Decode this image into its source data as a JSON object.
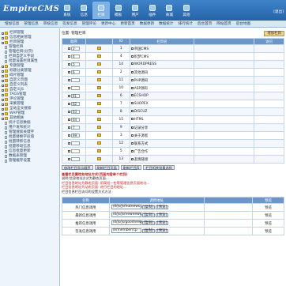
{
  "header": {
    "logo": "EmpireCMS",
    "nav": [
      {
        "label": "系统",
        "icon": "system-icon"
      },
      {
        "label": "信息",
        "icon": "info-icon"
      },
      {
        "label": "栏目",
        "icon": "column-icon",
        "active": true
      },
      {
        "label": "模板",
        "icon": "template-icon"
      },
      {
        "label": "用户",
        "icon": "user-icon"
      },
      {
        "label": "插件",
        "icon": "plugin-icon"
      },
      {
        "label": "商城",
        "icon": "shop-icon"
      },
      {
        "label": "其他",
        "icon": "other-icon"
      }
    ],
    "right_text": "[退出]",
    "accent": "#2f6fb5"
  },
  "subnav": [
    "增加信息",
    "管理信息",
    "审核信息",
    "签发信息",
    "管理评论",
    "更新中心",
    "更新首页",
    "数据更新",
    "数据统计",
    "排行统计",
    "后台首页",
    "网站首页",
    "后台地图"
  ],
  "sidebar": [
    {
      "label": "栏目管理",
      "level": 0,
      "type": "folder"
    },
    {
      "label": "信息相关管理",
      "level": 0,
      "type": "folder"
    },
    {
      "label": "栏目管理",
      "level": 0,
      "type": "folder"
    },
    {
      "label": "管理栏目",
      "level": 1,
      "type": "doc"
    },
    {
      "label": "管理栏目(分页)",
      "level": 1,
      "type": "doc"
    },
    {
      "label": "栏目自定义字段",
      "level": 1,
      "type": "doc"
    },
    {
      "label": "批量设置栏目属性",
      "level": 1,
      "type": "doc"
    },
    {
      "label": "专题管理",
      "level": 0,
      "type": "folder"
    },
    {
      "label": "标题分类管理",
      "level": 0,
      "type": "folder"
    },
    {
      "label": "碎片管理",
      "level": 0,
      "type": "folder"
    },
    {
      "label": "自定义页面",
      "level": 0,
      "type": "folder"
    },
    {
      "label": "自定义列表",
      "level": 0,
      "type": "folder"
    },
    {
      "label": "自定义JS",
      "level": 0,
      "type": "folder"
    },
    {
      "label": "TAGS管理",
      "level": 0,
      "type": "folder"
    },
    {
      "label": "评论管理",
      "level": 0,
      "type": "folder"
    },
    {
      "label": "采集管理",
      "level": 0,
      "type": "folder"
    },
    {
      "label": "全站全文搜索",
      "level": 0,
      "type": "folder"
    },
    {
      "label": "WAP管理",
      "level": 0,
      "type": "folder"
    },
    {
      "label": "其他相关",
      "level": 0,
      "type": "folder"
    },
    {
      "label": "统计信息数据",
      "level": 1,
      "type": "doc"
    },
    {
      "label": "用户发布统计",
      "level": 1,
      "type": "doc"
    },
    {
      "label": "管理搜索关键字",
      "level": 1,
      "type": "doc"
    },
    {
      "label": "批量替换字段值",
      "level": 1,
      "type": "doc"
    },
    {
      "label": "批量转移信息",
      "level": 1,
      "type": "doc"
    },
    {
      "label": "批量移动信息",
      "level": 1,
      "type": "doc"
    },
    {
      "label": "信息批量更新",
      "level": 1,
      "type": "doc"
    },
    {
      "label": "数据表管理",
      "level": 1,
      "type": "doc"
    },
    {
      "label": "管理缓存设置",
      "level": 1,
      "type": "doc"
    }
  ],
  "main": {
    "breadcrumb": "位置: 管理栏目",
    "add_button": "增加栏目",
    "columns": [
      "顺序",
      "",
      "ID",
      "栏目名",
      "",
      "访问"
    ],
    "rows": [
      {
        "order": "3",
        "id": "1",
        "name": "帝国CMS"
      },
      {
        "order": "4",
        "id": "4",
        "name": "织梦CMS"
      },
      {
        "order": "5",
        "id": "14",
        "name": "WORDPRESS"
      },
      {
        "order": "6",
        "id": "2",
        "name": "其他源码"
      },
      {
        "order": "",
        "id": "11",
        "name": "PHP源码"
      },
      {
        "order": "",
        "id": "10",
        "name": "ASP源码"
      },
      {
        "order": "61",
        "id": "6",
        "name": "ECSHOP"
      },
      {
        "order": "62",
        "id": "7",
        "name": "SHOPEX"
      },
      {
        "order": "63",
        "id": "8",
        "name": "DISCUZ"
      },
      {
        "order": "64",
        "id": "15",
        "name": "HTML"
      },
      {
        "order": "7",
        "id": "9",
        "name": "记录分享"
      },
      {
        "order": "99",
        "id": "3",
        "name": "关于源客"
      },
      {
        "order": "",
        "id": "12",
        "name": "联系方式"
      },
      {
        "order": "",
        "id": "5",
        "name": "广告合作"
      },
      {
        "order": "",
        "id": "13",
        "name": "友情链接"
      }
    ],
    "ops": [
      "修改栏目显示顺序",
      "刷新栏目页面",
      "刷新栏目JS",
      "栏目相关批量选择"
    ],
    "notes": {
      "title": "查看栏目属性和地址方式(页面内容单个栏目)",
      "line1": "说明:信息地址方式为静态页面...",
      "line2": "栏目信息地址为静态页面: 用简短一些等管理信息页面地址...",
      "line3": "栏目信息地址为动态页面: 进行栏目的地址...",
      "line4": "栏目信息栏目访问的设置方式方法"
    },
    "files_columns": [
      "名称",
      "调用地址",
      "",
      "预览"
    ],
    "files": [
      {
        "name": "热门信息调用",
        "path": "/d/js/js/hotnews.js",
        "view": "预览"
      },
      {
        "name": "最新信息调用",
        "path": "/d/js/js/newnews.js",
        "view": "预览"
      },
      {
        "name": "推荐信息调用",
        "path": "/d/js/js/goodnews.js",
        "view": "预览"
      },
      {
        "name": "签发信息调用",
        "path": "/e/member/cp",
        "view": "预览"
      }
    ],
    "file_btn1": "[复制]",
    "file_btn2": "[预览]"
  }
}
